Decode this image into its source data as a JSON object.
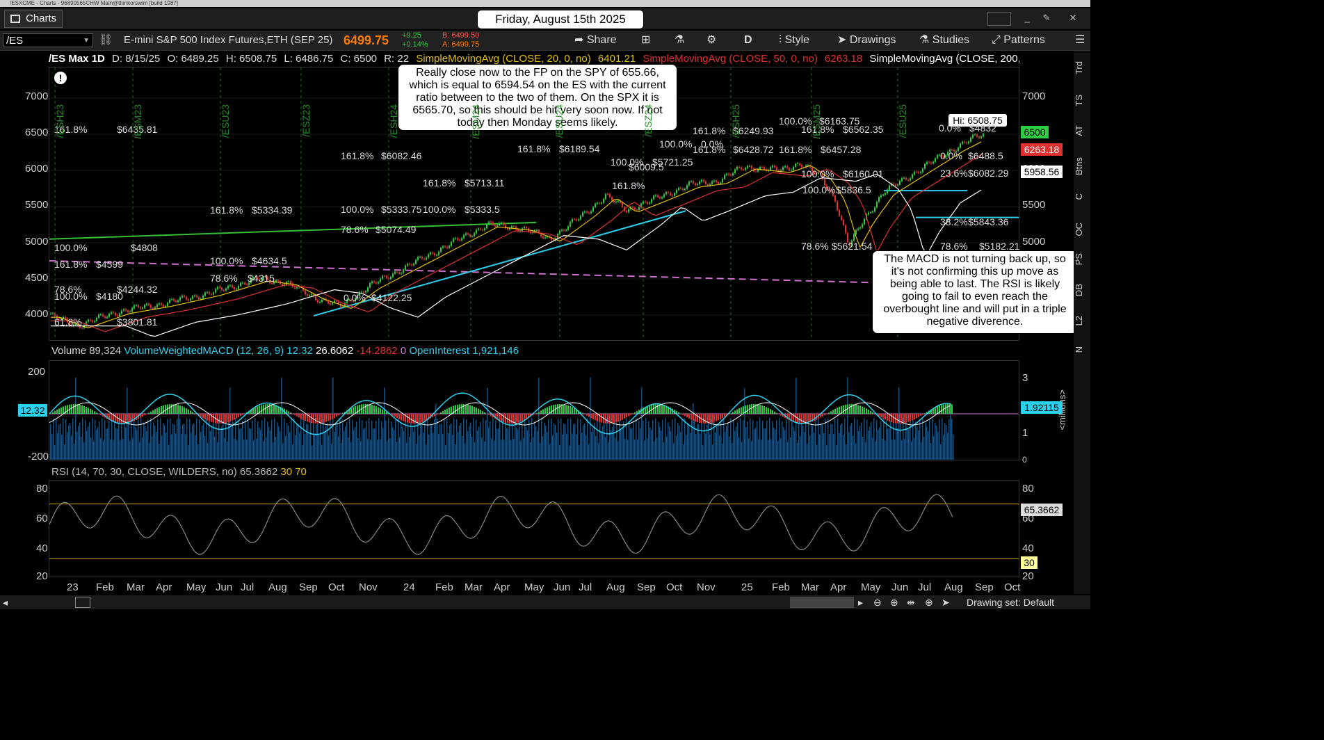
{
  "window": {
    "title": "/ESXCME - Charts - 96890565CHW Main@thinkorswim [build 1987]"
  },
  "topbar": {
    "charts_tab": "Charts",
    "date": "Friday, August 15th 2025"
  },
  "toolbar": {
    "symbol": "/ES",
    "description": "E-mini S&P 500 Index Futures,ETH (SEP 25)",
    "last_price": "6499.75",
    "change": "+9.25",
    "change_pct": "+0.14%",
    "bid": "B: 6499.50",
    "ask": "A: 6499.75",
    "share": "Share",
    "aggregation": "D",
    "style": "Style",
    "drawings": "Drawings",
    "studies": "Studies",
    "patterns": "Patterns"
  },
  "studybar": {
    "name": "/ES Max 1D",
    "date": "D: 8/15/25",
    "open": "O: 6489.25",
    "high": "H: 6508.75",
    "low": "L: 6486.75",
    "close": "C: 6500",
    "range": "R: 22",
    "sma20": "SimpleMovingAvg (CLOSE, 20, 0, no)",
    "sma20_val": "6401.21",
    "sma50": "SimpleMovingAvg (CLOSE, 50, 0, no)",
    "sma50_val": "6263.18",
    "sma200": "SimpleMovingAvg (CLOSE, 200, 0,..."
  },
  "price_axis": {
    "ticks": [
      "7000",
      "6500",
      "6000",
      "5500",
      "5000",
      "4500",
      "4000"
    ],
    "labels": {
      "hi": "Hi: 6508.75",
      "last": "6500",
      "sma50": "6263.18",
      "sma200": "5958.56"
    }
  },
  "volume_panel": {
    "header": {
      "volume": "Volume",
      "volume_val": "89,324",
      "macd": "VolumeWeightedMACD (12, 26, 9)",
      "v1": "12.32",
      "v2": "26.6062",
      "v3": "-14.2862",
      "v4": "0",
      "oi": "OpenInterest",
      "oi_val": "1,921,146"
    },
    "left_ticks": [
      "200",
      "-200"
    ],
    "right_ticks": [
      "3",
      "1",
      "0"
    ],
    "unit": "<millions>",
    "left_label": "12.32",
    "right_label": "1.92115"
  },
  "rsi_panel": {
    "header": {
      "rsi": "RSI (14, 70, 30, CLOSE, WILDERS, no)",
      "val": "65.3662",
      "ob": "30",
      "os": "70"
    },
    "ticks": [
      "80",
      "60",
      "40",
      "20"
    ],
    "right_ticks": [
      "80",
      "60",
      "40",
      "20"
    ],
    "label": "65.3662",
    "line30": "30"
  },
  "x_axis": [
    "23",
    "Feb",
    "Mar",
    "Apr",
    "May",
    "Jun",
    "Jul",
    "Aug",
    "Sep",
    "Oct",
    "Nov",
    "24",
    "Feb",
    "Mar",
    "Apr",
    "May",
    "Jun",
    "Jul",
    "Aug",
    "Sep",
    "Oct",
    "Nov",
    "25",
    "Feb",
    "Mar",
    "Apr",
    "May",
    "Jun",
    "Jul",
    "Aug",
    "Sep",
    "Oct"
  ],
  "contract_labels": [
    "/ESH23",
    "/ESM23",
    "/ESU23",
    "/ESZ23",
    "/ESH24",
    "/ESM24",
    "/ESU24",
    "/ESZ24",
    "/ESH25",
    "/ESM25",
    "/ESU25"
  ],
  "annotations": {
    "top": "Really close now to the FP on the SPY of 655.66, which is equal to 6594.54 on the ES with the current ratio between to the two of them.  On the SPX it is 6565.70, so this should be hit very soon now.  If not today then Monday seems likely.",
    "right": "The MACD is not turning back up, so it's not confirming this up move as being able to last.  The RSI is likely going to fail to even reach the overbought line and will put in a triple negative diverence."
  },
  "fib_labels": [
    "161.8%",
    "$6435.81",
    "100.0%",
    "$4808",
    "161.8%",
    "$4599",
    "78.6%",
    "$4244.32",
    "100.0%",
    "$4180",
    "61.8%",
    "$3801.81",
    "161.8%",
    "$5334.39",
    "100.0%",
    "$4634.5",
    "78.6%",
    "$4315",
    "0.0%",
    "$4122.25",
    "161.8%",
    "$6082.46",
    "100.0%",
    "$5333.75",
    "78.6%",
    "$5074.49",
    "161.8%",
    "$5713.11",
    "100.0%",
    "$5333.5",
    "161.8%",
    "$6189.54",
    "100.0%",
    "$5721.25",
    "161.8%",
    "$6009.5",
    "100.0%",
    "0.0%",
    "161.8%",
    "$6249.93",
    "161.8%",
    "$6428.72",
    "100.0%",
    "$6163.75",
    "161.8%",
    "$6562.35",
    "161.8%",
    "$6457.28",
    "100.0%",
    "$6160.01",
    "100.0%",
    "$5836.5",
    "78.6%",
    "$5621.54",
    "0.0%",
    "$4832",
    "0.0%",
    "$6488.5",
    "23.6%",
    "$6082.29",
    "38.2%",
    "$5843.36",
    "78.6%",
    "$5182.21",
    "100.0%",
    "$4832"
  ],
  "right_strip": [
    "Trd",
    "TS",
    "AT",
    "Btns",
    "C",
    "OC",
    "PS",
    "DB",
    "L2",
    "N"
  ],
  "bottom": {
    "drawing_set": "Drawing set: Default"
  },
  "colors": {
    "up": "#2ecc40",
    "down": "#e03030",
    "accent": "#ff7a00",
    "sma50": "#e03030",
    "cyan": "#2ad2f0",
    "pink": "#d070d0",
    "green_line": "#35c135"
  }
}
